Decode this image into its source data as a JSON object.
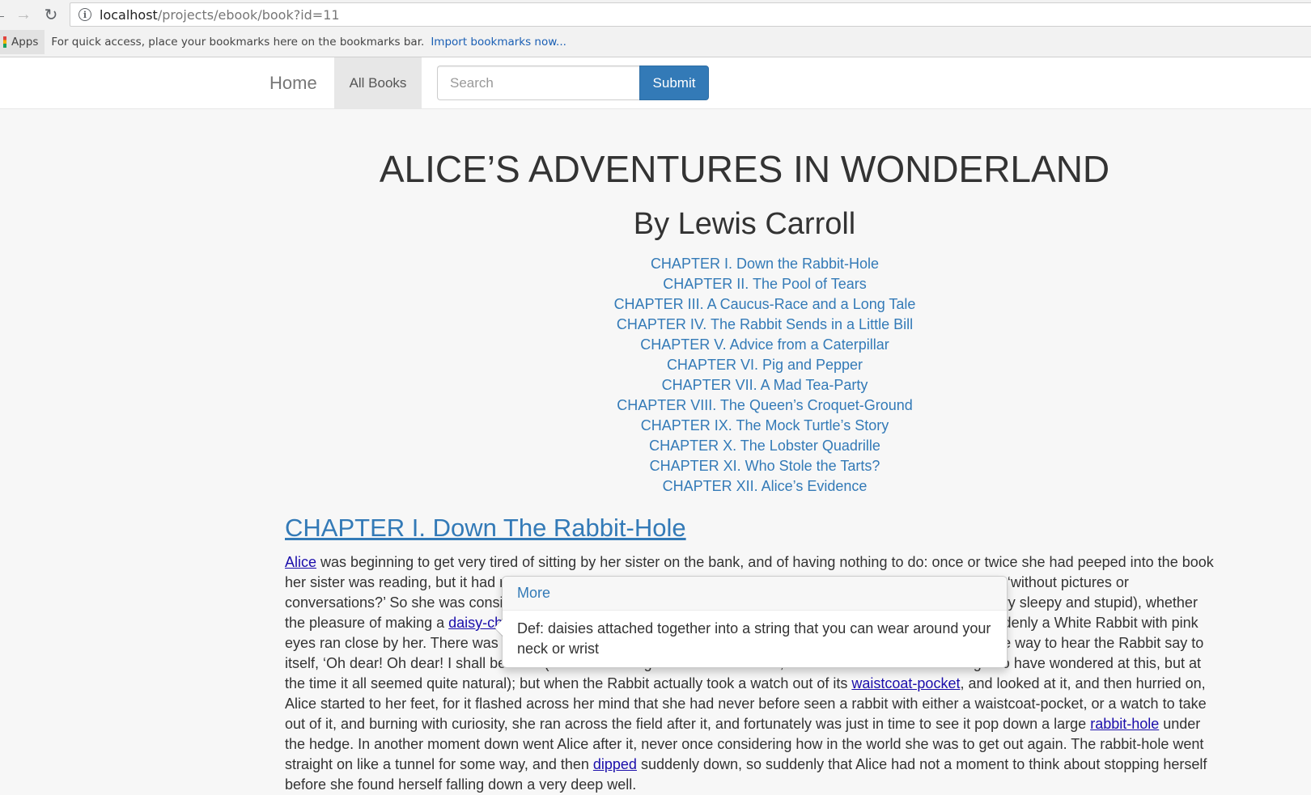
{
  "browser": {
    "url_host": "localhost",
    "url_path": "/projects/ebook/book?id=11",
    "apps_label": "Apps",
    "bookmarks_hint": "For quick access, place your bookmarks here on the bookmarks bar.",
    "import_link": "Import bookmarks now..."
  },
  "navbar": {
    "brand": "Home",
    "all_books": "All Books",
    "search_placeholder": "Search",
    "submit_label": "Submit"
  },
  "book": {
    "title": "ALICE’S ADVENTURES IN WONDERLAND",
    "author": "By Lewis Carroll",
    "toc": [
      "CHAPTER I. Down the Rabbit-Hole",
      "CHAPTER II. The Pool of Tears",
      "CHAPTER III. A Caucus-Race and a Long Tale",
      "CHAPTER IV. The Rabbit Sends in a Little Bill",
      "CHAPTER V. Advice from a Caterpillar",
      "CHAPTER VI. Pig and Pepper",
      "CHAPTER VII. A Mad Tea-Party",
      "CHAPTER VIII. The Queen’s Croquet-Ground",
      "CHAPTER IX. The Mock Turtle’s Story",
      "CHAPTER X. The Lobster Quadrille",
      "CHAPTER XI. Who Stole the Tarts?",
      "CHAPTER XII. Alice’s Evidence"
    ]
  },
  "chapter": {
    "heading": "CHAPTER I. Down The Rabbit-Hole",
    "segments": [
      {
        "link": "Alice"
      },
      {
        "text": " was beginning to get very tired of sitting by her sister on the bank, and of having nothing to do: once or twice she had peeped into the book her sister was reading, but it had no pictures or conversations in it, ‘and what is the use of a book,’ thought Alice ‘without pictures or conversations?’ So she was considering in her own mind (as well as she could, for the hot day made her feel very sleepy and stupid), whether the pleasure of making a "
      },
      {
        "link": "daisy-chain"
      },
      {
        "text": " would be worth the trouble of getting up and picking the daisies, when suddenly a White Rabbit with pink eyes ran close by her. There was nothing so very remarkable in that; nor did Alice think it so very much out of the way to hear the Rabbit say to itself, ‘Oh dear! Oh dear! I shall be late!’ (when she thought it over afterwards, it occurred to her that she ought to have wondered at this, but at the time it all seemed quite natural); but when the Rabbit actually took a watch out of its "
      },
      {
        "link": "waistcoat-pocket"
      },
      {
        "text": ", and looked at it, and then hurried on, Alice started to her feet, for it flashed across her mind that she had never before seen a rabbit with either a waistcoat-pocket, or a watch to take out of it, and burning with curiosity, she ran across the field after it, and fortunately was just in time to see it pop down a large "
      },
      {
        "link": "rabbit-hole"
      },
      {
        "text": " under the hedge. In another moment down went Alice after it, never once considering how in the world she was to get out again. The rabbit-hole went straight on like a tunnel for some way, and then "
      },
      {
        "link": "dipped"
      },
      {
        "text": " suddenly down, so suddenly that Alice had not a moment to think about stopping herself before she found herself falling down a very deep well."
      }
    ]
  },
  "popover": {
    "title": "More",
    "definition": "Def: daisies attached together into a string that you can wear around your neck or wrist"
  }
}
